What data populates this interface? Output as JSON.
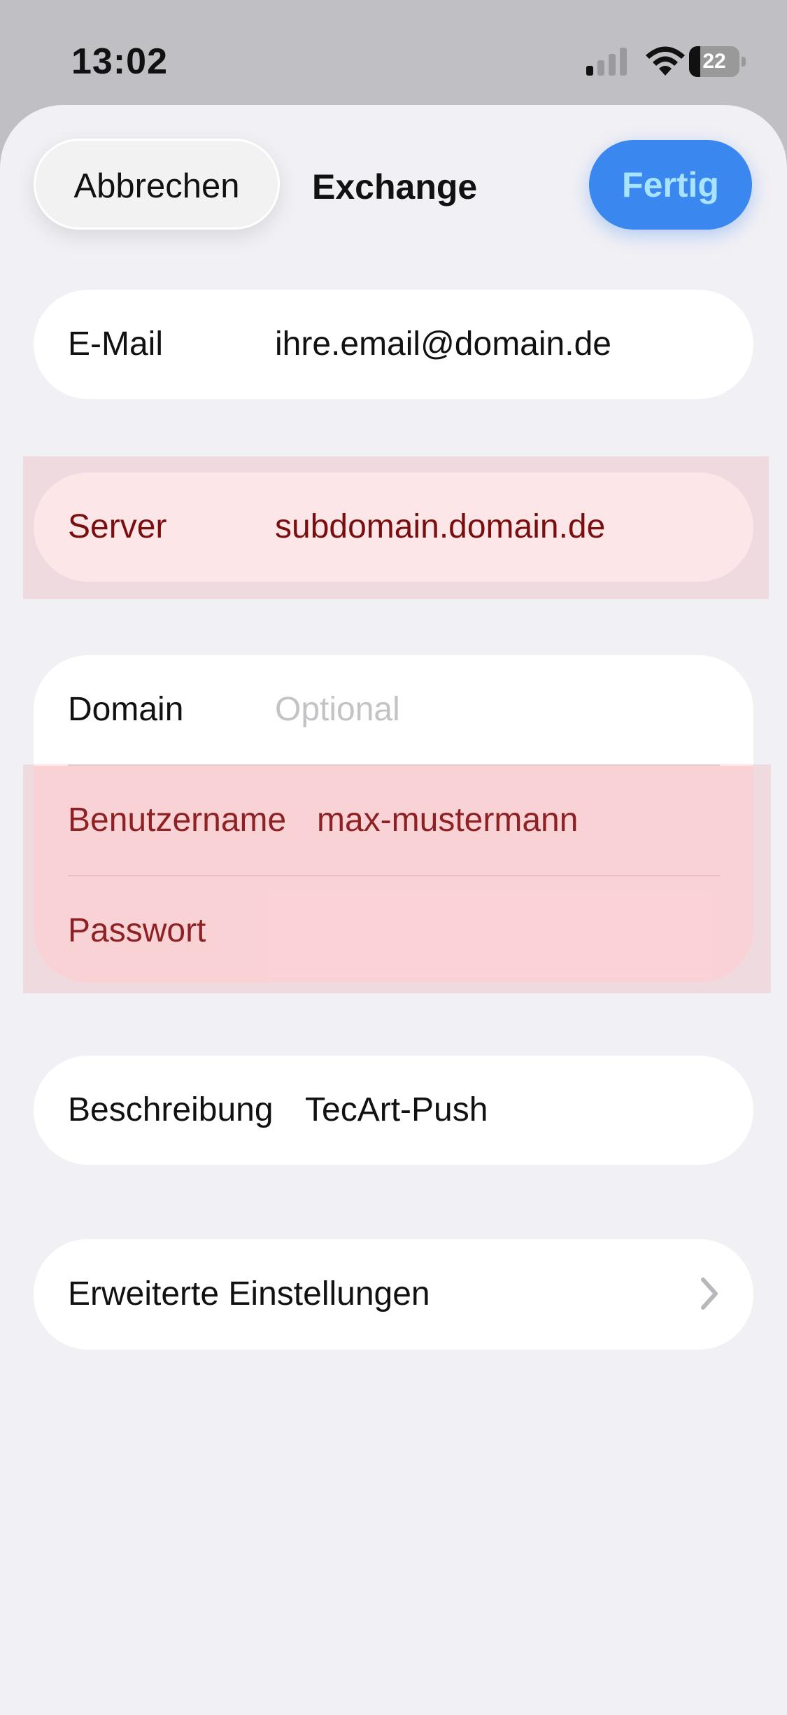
{
  "status_bar": {
    "time": "13:02",
    "battery_level": "22",
    "battery_fraction": 0.22,
    "icons": [
      "cellular-signal-icon",
      "wifi-icon",
      "battery-icon"
    ]
  },
  "nav": {
    "cancel_label": "Abbrechen",
    "title": "Exchange",
    "done_label": "Fertig"
  },
  "account": {
    "email": {
      "label": "E-Mail",
      "value": "ihre.email@domain.de"
    },
    "server": {
      "label": "Server",
      "value": "subdomain.domain.de"
    },
    "domain": {
      "label": "Domain",
      "placeholder": "Optional",
      "value": ""
    },
    "username": {
      "label": "Benutzername",
      "value": "max-mustermann"
    },
    "password": {
      "label": "Passwort",
      "value": ""
    },
    "description": {
      "label": "Beschreibung",
      "value": "TecArt-Push"
    },
    "advanced": {
      "label": "Erweiterte Einstellungen",
      "icon": "chevron-right-icon"
    }
  },
  "colors": {
    "accent": "#3a87f0",
    "done_text": "#a8e3ff",
    "error_text": "#7a0e0e",
    "error_background": "#fde6e8",
    "background": "#f1f0f5"
  }
}
